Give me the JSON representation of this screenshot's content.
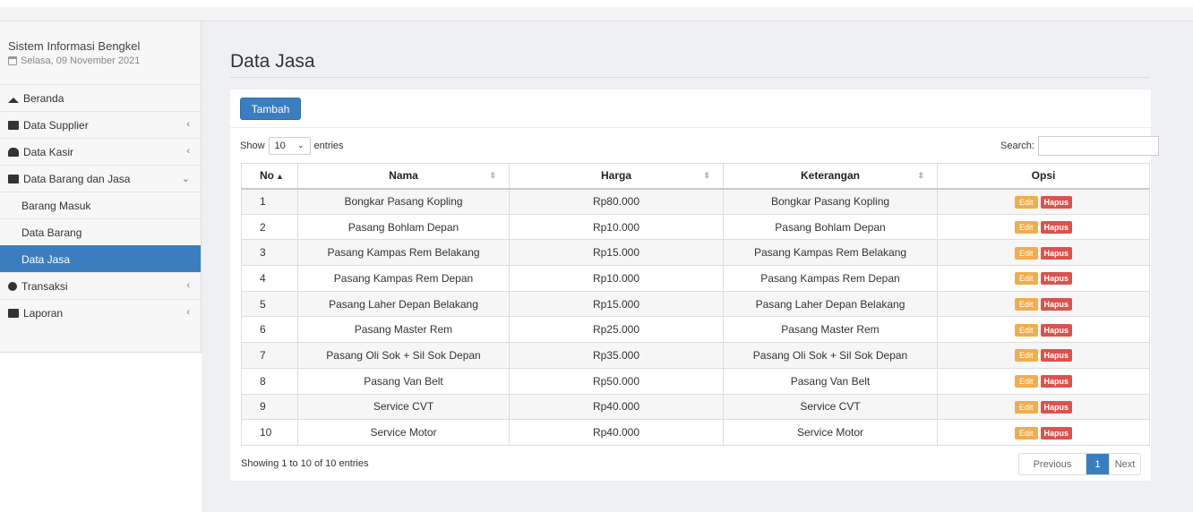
{
  "app": {
    "name": "Sistem Informasi Bengkel",
    "date": "Selasa, 09 November 2021"
  },
  "sidebar": {
    "items": [
      {
        "label": "Beranda",
        "icon": "home-icon"
      },
      {
        "label": "Data Supplier",
        "icon": "link-icon",
        "chevron": "‹"
      },
      {
        "label": "Data Kasir",
        "icon": "users-icon",
        "chevron": "‹"
      },
      {
        "label": "Data Barang dan Jasa",
        "icon": "grid-icon",
        "chevron": "⌄"
      },
      {
        "label": "Barang Masuk"
      },
      {
        "label": "Data Barang"
      },
      {
        "label": "Data Jasa",
        "active": true
      },
      {
        "label": "Transaksi",
        "icon": "gear-icon",
        "chevron": "‹"
      },
      {
        "label": "Laporan",
        "icon": "folder-icon",
        "chevron": "‹"
      }
    ]
  },
  "page": {
    "title": "Data Jasa",
    "add_button": "Tambah",
    "show_label": "Show",
    "entries_label": "entries",
    "page_length": "10",
    "search_label": "Search:",
    "search_value": ""
  },
  "table": {
    "headers": [
      "No",
      "Nama",
      "Harga",
      "Keterangan",
      "Opsi"
    ],
    "edit_label": "Edit",
    "delete_label": "Hapus",
    "rows": [
      {
        "no": "1",
        "nama": "Bongkar Pasang Kopling",
        "harga": "Rp80.000",
        "keterangan": "Bongkar Pasang Kopling"
      },
      {
        "no": "2",
        "nama": "Pasang Bohlam Depan",
        "harga": "Rp10.000",
        "keterangan": "Pasang Bohlam Depan"
      },
      {
        "no": "3",
        "nama": "Pasang Kampas Rem Belakang",
        "harga": "Rp15.000",
        "keterangan": "Pasang Kampas Rem Belakang"
      },
      {
        "no": "4",
        "nama": "Pasang Kampas Rem Depan",
        "harga": "Rp10.000",
        "keterangan": "Pasang Kampas Rem Depan"
      },
      {
        "no": "5",
        "nama": "Pasang Laher Depan Belakang",
        "harga": "Rp15.000",
        "keterangan": "Pasang Laher Depan Belakang"
      },
      {
        "no": "6",
        "nama": "Pasang Master Rem",
        "harga": "Rp25.000",
        "keterangan": "Pasang Master Rem"
      },
      {
        "no": "7",
        "nama": "Pasang Oli Sok + Sil Sok Depan",
        "harga": "Rp35.000",
        "keterangan": "Pasang Oli Sok + Sil Sok Depan"
      },
      {
        "no": "8",
        "nama": "Pasang Van Belt",
        "harga": "Rp50.000",
        "keterangan": "Pasang Van Belt"
      },
      {
        "no": "9",
        "nama": "Service CVT",
        "harga": "Rp40.000",
        "keterangan": "Service CVT"
      },
      {
        "no": "10",
        "nama": "Service Motor",
        "harga": "Rp40.000",
        "keterangan": "Service Motor"
      }
    ]
  },
  "footer": {
    "info": "Showing 1 to 10 of 10 entries",
    "previous": "Previous",
    "current_page": "1",
    "next": "Next"
  },
  "colors": {
    "primary": "#3b7ec0",
    "edit": "#f0ad4e",
    "delete": "#d9534f"
  }
}
